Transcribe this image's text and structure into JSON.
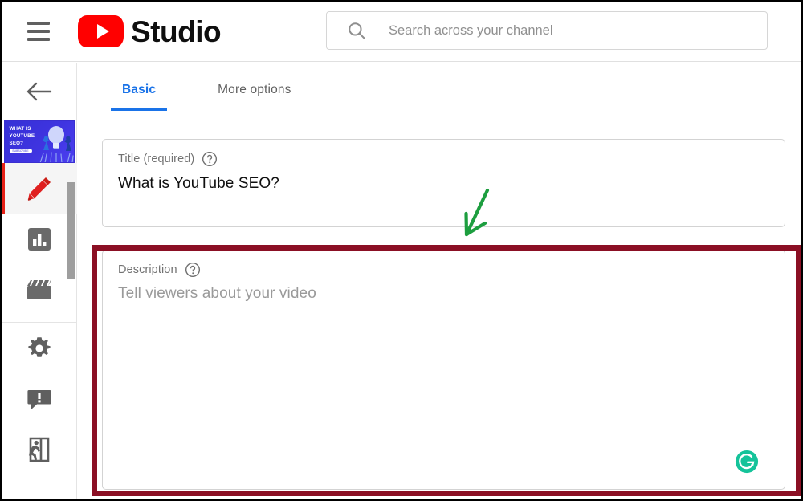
{
  "header": {
    "menu_icon": "hamburger-menu-icon",
    "logo_icon": "youtube-play-logo",
    "brand": "Studio",
    "search": {
      "icon": "search-icon",
      "placeholder": "Search across your channel",
      "value": ""
    }
  },
  "sidebar": {
    "back_icon": "back-arrow-icon",
    "thumbnail": {
      "name": "video-thumbnail",
      "line1": "WHAT IS",
      "line2": "YOUTUBE",
      "line3": "SEO?",
      "pill": "SUBSCRIBE NOW",
      "bg_color": "#3530d6"
    },
    "items": [
      {
        "name": "sidebar-item-details",
        "icon": "pencil-icon",
        "active": true
      },
      {
        "name": "sidebar-item-analytics",
        "icon": "bar-chart-icon",
        "active": false
      },
      {
        "name": "sidebar-item-editor",
        "icon": "film-clapper-icon",
        "active": false
      },
      {
        "name": "sidebar-item-settings",
        "icon": "gear-icon",
        "active": false
      },
      {
        "name": "sidebar-item-feedback",
        "icon": "comment-alert-icon",
        "active": false
      },
      {
        "name": "sidebar-item-exit",
        "icon": "exit-running-man-icon",
        "active": false
      }
    ],
    "scrollbar": "vertical-scrollbar"
  },
  "main": {
    "tabs": [
      {
        "label": "Basic",
        "active": true
      },
      {
        "label": "More options",
        "active": false
      }
    ],
    "title_field": {
      "label": "Title (required)",
      "help_icon": "help-circle-icon",
      "value": "What is YouTube SEO?"
    },
    "description_field": {
      "label": "Description",
      "help_icon": "help-circle-icon",
      "placeholder": "Tell viewers about your video",
      "value": "",
      "assistant_icon": "grammarly-icon"
    }
  },
  "annotations": {
    "highlight_rect": {
      "name": "description-highlight-box",
      "color": "#8b0f24"
    },
    "arrow": {
      "name": "pointer-arrow",
      "color": "#1d9e3f",
      "direction": "down-left"
    }
  },
  "colors": {
    "youtube_red": "#ff0000",
    "accent_blue": "#1a73e8",
    "active_red": "#e62117",
    "grammarly_green": "#15c39a",
    "annotation_red": "#8b0f24",
    "annotation_green": "#1d9e3f"
  }
}
